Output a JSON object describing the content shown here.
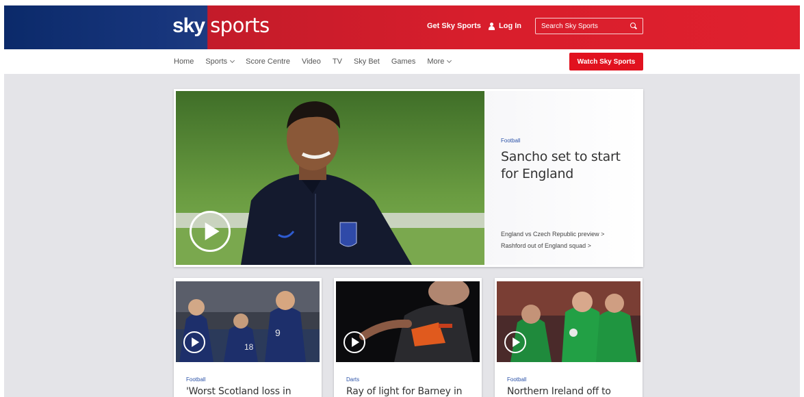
{
  "header": {
    "logo_sky": "sky",
    "logo_sports": "sports",
    "get_sky_label": "Get Sky Sports",
    "login_label": "Log In",
    "search_placeholder": "Search Sky Sports"
  },
  "nav": {
    "items": [
      {
        "label": "Home",
        "dropdown": false
      },
      {
        "label": "Sports",
        "dropdown": true
      },
      {
        "label": "Score Centre",
        "dropdown": false
      },
      {
        "label": "Video",
        "dropdown": false
      },
      {
        "label": "TV",
        "dropdown": false
      },
      {
        "label": "Sky Bet",
        "dropdown": false
      },
      {
        "label": "Games",
        "dropdown": false
      },
      {
        "label": "More",
        "dropdown": true
      }
    ],
    "watch_label": "Watch Sky Sports"
  },
  "hero": {
    "category": "Football",
    "title": "Sancho set to start for England",
    "links": [
      "England vs Czech Republic preview >",
      "Rashford out of England squad >"
    ]
  },
  "cards": [
    {
      "category": "Football",
      "title": "'Worst Scotland loss in"
    },
    {
      "category": "Darts",
      "title": "Ray of light for Barney in"
    },
    {
      "category": "Football",
      "title": "Northern Ireland off to"
    }
  ],
  "colors": {
    "brand_blue": "#0b2a6a",
    "brand_red": "#e1121f",
    "category_blue": "#2b52a8"
  }
}
